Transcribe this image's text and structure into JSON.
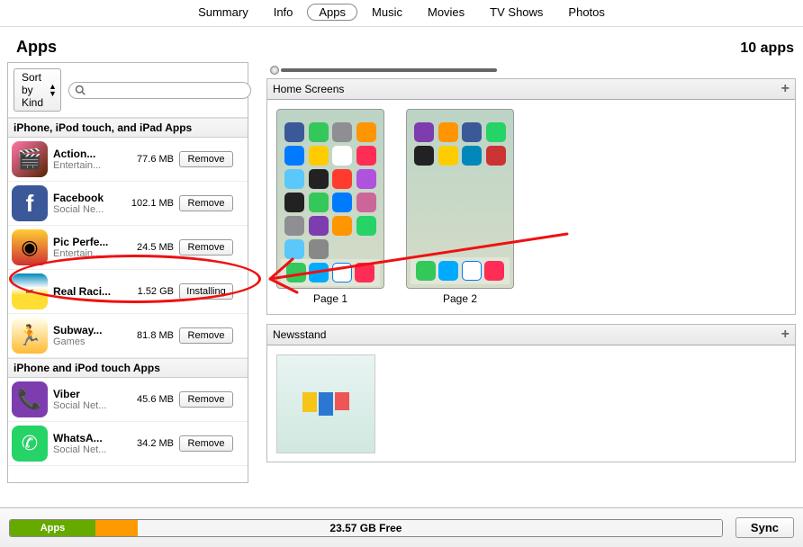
{
  "tabs": [
    "Summary",
    "Info",
    "Apps",
    "Music",
    "Movies",
    "TV Shows",
    "Photos"
  ],
  "active_tab": "Apps",
  "header": {
    "title": "Apps",
    "count": "10 apps"
  },
  "sort": {
    "label": "Sort by Kind"
  },
  "search": {
    "placeholder": ""
  },
  "sections": [
    {
      "title": "iPhone, iPod touch, and iPad Apps"
    },
    {
      "title": "iPhone and iPod touch Apps"
    }
  ],
  "apps1": [
    {
      "name": "Action...",
      "cat": "Entertain...",
      "size": "77.6 MB",
      "btn": "Remove"
    },
    {
      "name": "Facebook",
      "cat": "Social Ne...",
      "size": "102.1 MB",
      "btn": "Remove"
    },
    {
      "name": "Pic Perfe...",
      "cat": "Entertain...",
      "size": "24.5 MB",
      "btn": "Remove"
    },
    {
      "name": "Real Raci...",
      "cat": "",
      "size": "1.52 GB",
      "btn": "Installing"
    },
    {
      "name": "Subway...",
      "cat": "Games",
      "size": "81.8 MB",
      "btn": "Remove"
    }
  ],
  "apps2": [
    {
      "name": "Viber",
      "cat": "Social Net...",
      "size": "45.6 MB",
      "btn": "Remove"
    },
    {
      "name": "WhatsA...",
      "cat": "Social Net...",
      "size": "34.2 MB",
      "btn": "Remove"
    }
  ],
  "right": {
    "home_title": "Home Screens",
    "newsstand_title": "Newsstand",
    "pages": [
      "Page 1",
      "Page 2"
    ]
  },
  "footer": {
    "apps_label": "Apps",
    "free": "23.57 GB Free",
    "sync": "Sync"
  }
}
